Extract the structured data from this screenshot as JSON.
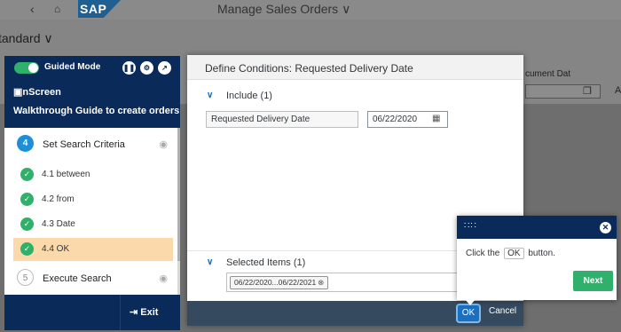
{
  "shell": {
    "app_title": "Manage Sales Orders ∨",
    "logo": "SAP",
    "variant": "tandard ∨"
  },
  "background": {
    "doc_label": "cument Dat",
    "doc_a": "A"
  },
  "guide": {
    "mode_label": "Guided Mode",
    "brand": "▣nScreen",
    "title": "Walkthrough Guide to create orders",
    "steps": [
      {
        "num": "4",
        "label": "Set Search Criteria"
      },
      {
        "num": "4.1",
        "label": "4.1 between"
      },
      {
        "num": "4.2",
        "label": "4.2 from"
      },
      {
        "num": "4.3",
        "label": "4.3 Date"
      },
      {
        "num": "4.4",
        "label": "4.4 OK"
      },
      {
        "num": "5",
        "label": "Execute Search"
      }
    ],
    "exit_label": "Exit"
  },
  "dialog": {
    "title": "Define Conditions: Requested Delivery Date",
    "include_label": "Include (1)",
    "condition_field": "Requested Delivery Date",
    "date_value": "06/22/2020",
    "selected_label": "Selected Items (1)",
    "token": "06/22/2020...06/22/2021",
    "ok_label": "OK",
    "cancel_label": "Cancel"
  },
  "tooltip": {
    "text_before": "Click the",
    "ok_word": "OK",
    "text_after": "button.",
    "next_label": "Next"
  },
  "colors": {
    "panel_navy": "#0a2a5a",
    "accent_green": "#2fb06b",
    "active_step": "#fbd9ab",
    "dialog_footer": "#354a5f",
    "sap_blue": "#0a6ed1"
  }
}
